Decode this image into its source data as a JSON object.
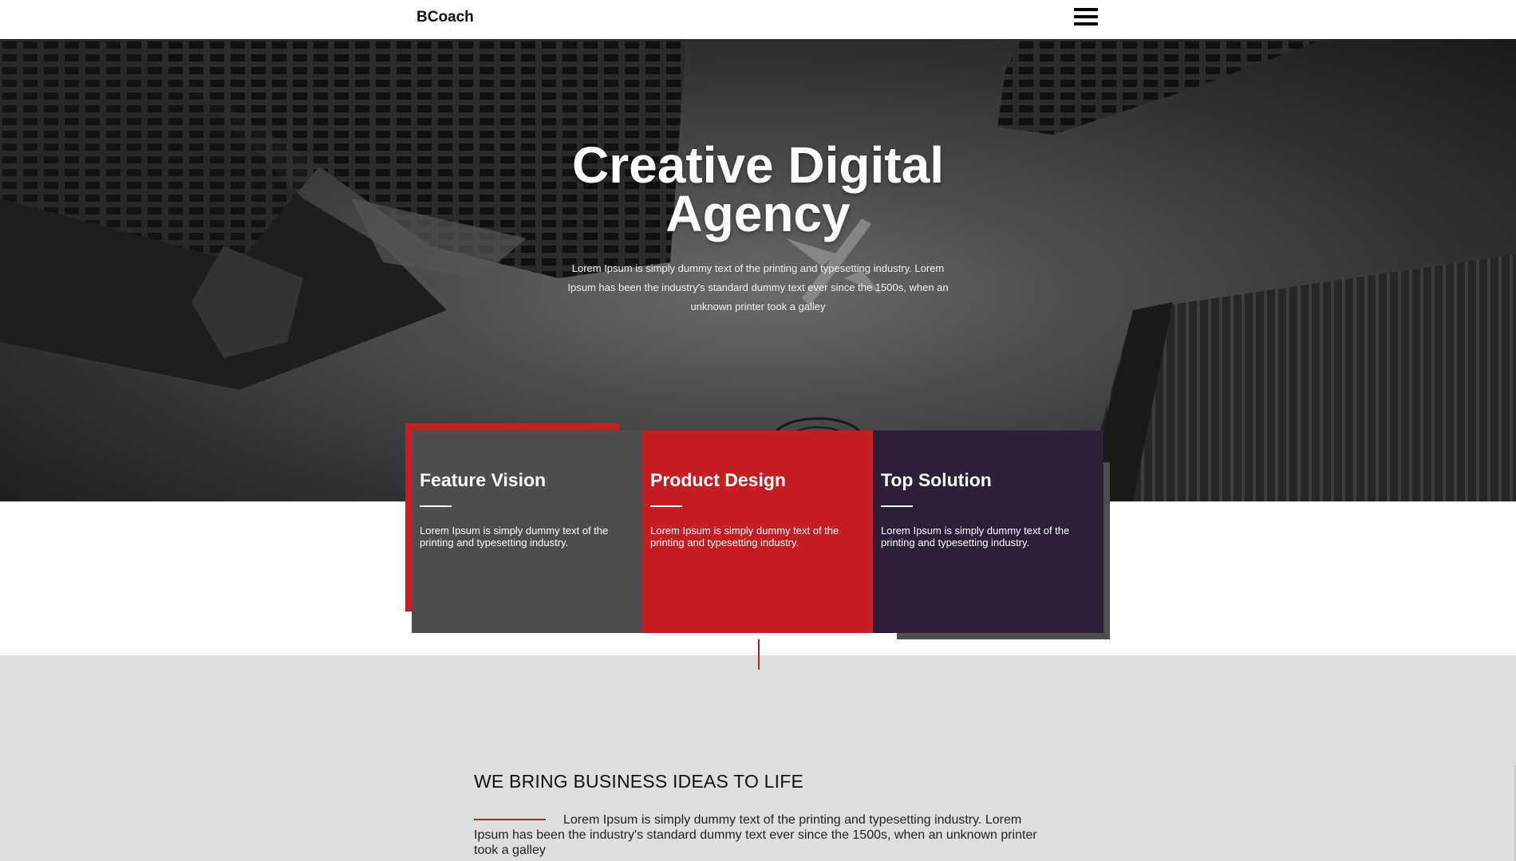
{
  "header": {
    "brand": "BCoach"
  },
  "hero": {
    "title_line1": "Creative Digital",
    "title_line2": "Agency",
    "text": "Lorem Ipsum is simply dummy text of the printing and typesetting industry. Lorem Ipsum has been the industry's standard dummy text ever since the 1500s, when an unknown printer took a galley"
  },
  "features": [
    {
      "title": "Feature Vision",
      "text": "Lorem Ipsum is simply dummy text of the printing and typesetting industry.",
      "color": "#4d4d4d"
    },
    {
      "title": "Product Design",
      "text": "Lorem Ipsum is simply dummy text of the printing and typesetting industry.",
      "color": "#c41e22"
    },
    {
      "title": "Top Solution",
      "text": "Lorem Ipsum is simply dummy text of the printing and typesetting industry.",
      "color": "#2d1f38"
    }
  ],
  "about": {
    "heading": "WE BRING BUSINESS IDEAS TO LIFE",
    "text": "Lorem Ipsum is simply dummy text of the printing and typesetting industry. Lorem Ipsum has been the industry's standard dummy text ever since the 1500s, when an unknown printer took a galley"
  },
  "colors": {
    "accent": "#c41e22",
    "dark_grey": "#4d4d4d",
    "purple": "#2d1f38",
    "section_bg": "#dedede"
  },
  "icons": {
    "menu": "hamburger-menu-icon"
  }
}
